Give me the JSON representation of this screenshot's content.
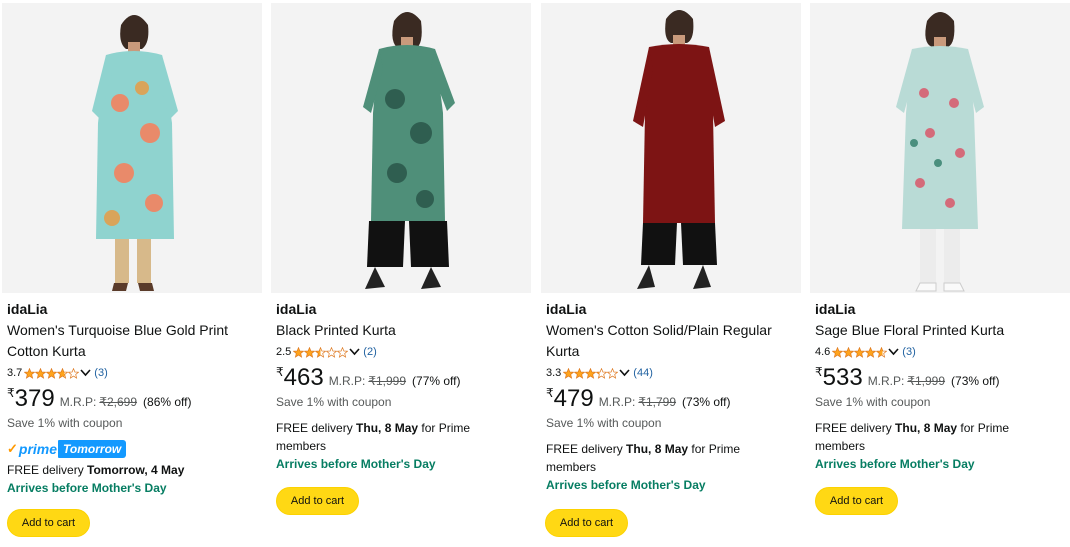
{
  "colors": {
    "star": "#ffa41c",
    "link": "#2162a1",
    "prime_blue": "#1399ff",
    "green": "#067d62",
    "button": "#ffd814"
  },
  "products": [
    {
      "brand": "idaLia",
      "title": "Women's Turquoise Blue Gold Print Cotton Kurta",
      "rating": "3.7",
      "stars": 3.7,
      "rating_count": "(3)",
      "currency": "₹",
      "price": "379",
      "mrp_label": "M.R.P:",
      "mrp": "₹2,699",
      "off": "(86% off)",
      "coupon": "Save 1% with coupon",
      "prime": true,
      "prime_label": "prime",
      "prime_tag": "Tomorrow",
      "delivery_prefix": "FREE delivery ",
      "delivery_date": "Tomorrow, 4 May",
      "delivery_suffix": "",
      "arrives": "Arrives before Mother's Day",
      "add_to_cart": "Add to cart"
    },
    {
      "brand": "idaLia",
      "title": "Black Printed Kurta",
      "rating": "2.5",
      "stars": 2.5,
      "rating_count": "(2)",
      "currency": "₹",
      "price": "463",
      "mrp_label": "M.R.P:",
      "mrp": "₹1,999",
      "off": "(77% off)",
      "coupon": "Save 1% with coupon",
      "prime": false,
      "delivery_prefix": "FREE delivery ",
      "delivery_date": "Thu, 8 May",
      "delivery_suffix": " for Prime members",
      "arrives": "Arrives before Mother's Day",
      "add_to_cart": "Add to cart"
    },
    {
      "brand": "idaLia",
      "title": "Women's Cotton Solid/Plain Regular Kurta",
      "rating": "3.3",
      "stars": 3.3,
      "rating_count": "(44)",
      "currency": "₹",
      "price": "479",
      "mrp_label": "M.R.P:",
      "mrp": "₹1,799",
      "off": "(73% off)",
      "coupon": "Save 1% with coupon",
      "prime": false,
      "delivery_prefix": "FREE delivery ",
      "delivery_date": "Thu, 8 May",
      "delivery_suffix": " for Prime members",
      "arrives": "Arrives before Mother's Day",
      "add_to_cart": "Add to cart"
    },
    {
      "brand": "idaLia",
      "title": "Sage Blue Floral Printed Kurta",
      "rating": "4.6",
      "stars": 4.6,
      "rating_count": "(3)",
      "currency": "₹",
      "price": "533",
      "mrp_label": "M.R.P:",
      "mrp": "₹1,999",
      "off": "(73% off)",
      "coupon": "Save 1% with coupon",
      "prime": false,
      "delivery_prefix": "FREE delivery ",
      "delivery_date": "Thu, 8 May",
      "delivery_suffix": " for Prime members",
      "arrives": "Arrives before Mother's Day",
      "add_to_cart": "Add to cart"
    }
  ]
}
